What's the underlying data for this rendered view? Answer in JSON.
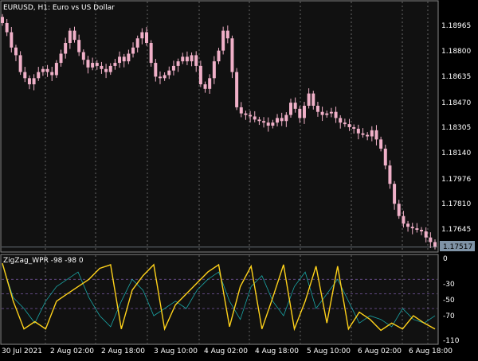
{
  "header": {
    "symbol_info": "EURUSD, H1:  Euro vs US Dollar"
  },
  "indicator": {
    "label": "ZigZag_WPR -98 -98 0"
  },
  "price_axis": {
    "labels": [
      "1.18965",
      "1.18800",
      "1.18635",
      "1.18470",
      "1.18305",
      "1.18140",
      "1.17976",
      "1.17810",
      "1.17645"
    ],
    "current_price": "1.17517"
  },
  "indicator_axis": {
    "labels": [
      "0",
      "-30",
      "-50",
      "-70",
      "-110"
    ]
  },
  "time_axis": {
    "labels": [
      "30 Jul 2021",
      "2 Aug 02:00",
      "2 Aug 18:00",
      "3 Aug 10:00",
      "4 Aug 02:00",
      "4 Aug 18:00",
      "5 Aug 10:00",
      "6 Aug 02:00",
      "6 Aug 18:00"
    ]
  },
  "colors": {
    "background": "#000000",
    "chart_bg": "#111111",
    "grid": "#8a8a8a",
    "candle": "#f0b0c8",
    "zigzag": "#ffd21a",
    "wpr_line": "#1aa6a6",
    "level_line": "#7b5aa6",
    "axis_text": "#ffffff",
    "price_badge": "#7f93a6"
  },
  "chart_data": [
    {
      "type": "candlestick",
      "title": "EURUSD, H1:  Euro vs US Dollar",
      "y_ticks": [
        1.18965,
        1.188,
        1.18635,
        1.1847,
        1.18305,
        1.1814,
        1.17976,
        1.1781,
        1.17645
      ],
      "last_price": 1.17517,
      "ylim": [
        1.1749,
        1.1912
      ],
      "close_path": [
        1.1898,
        1.1892,
        1.1882,
        1.1877,
        1.1866,
        1.1862,
        1.1858,
        1.1862,
        1.1866,
        1.1868,
        1.1866,
        1.1864,
        1.1872,
        1.1878,
        1.1885,
        1.1893,
        1.1887,
        1.1879,
        1.1874,
        1.1869,
        1.1872,
        1.187,
        1.1868,
        1.1866,
        1.187,
        1.1872,
        1.1876,
        1.1873,
        1.1878,
        1.1882,
        1.1888,
        1.1892,
        1.1885,
        1.1872,
        1.1863,
        1.1862,
        1.1864,
        1.1867,
        1.187,
        1.1873,
        1.1876,
        1.1873,
        1.1877,
        1.187,
        1.1858,
        1.1855,
        1.1862,
        1.1873,
        1.188,
        1.1893,
        1.1888,
        1.1866,
        1.1843,
        1.1839,
        1.1838,
        1.1837,
        1.1835,
        1.1834,
        1.1833,
        1.1831,
        1.1833,
        1.1836,
        1.1834,
        1.1838,
        1.1846,
        1.1842,
        1.1836,
        1.1844,
        1.1852,
        1.1844,
        1.184,
        1.1838,
        1.1839,
        1.184,
        1.1836,
        1.1833,
        1.1832,
        1.183,
        1.1829,
        1.1826,
        1.1825,
        1.1824,
        1.1828,
        1.1822,
        1.1816,
        1.1805,
        1.1793,
        1.178,
        1.1772,
        1.1767,
        1.1765,
        1.1764,
        1.1763,
        1.1762,
        1.1758,
        1.1755,
        1.1752
      ]
    },
    {
      "type": "line",
      "title": "ZigZag_WPR -98 -98 0",
      "y_ticks": [
        0,
        -30,
        -50,
        -70,
        -110
      ],
      "levels": [
        -30,
        -50,
        -70
      ],
      "ylim": [
        -118,
        3
      ],
      "series": [
        {
          "values": [
            -8,
            -60,
            -98,
            -88,
            -98,
            -60,
            -50,
            -40,
            -30,
            -15,
            -10,
            -98,
            -45,
            -25,
            -10,
            -98,
            -65,
            -50,
            -35,
            -20,
            -10,
            -95,
            -40,
            -12,
            -98,
            -55,
            -10,
            -98,
            -60,
            -12,
            -90,
            -12,
            -98,
            -75,
            -85,
            -100,
            -90,
            -98,
            -80,
            -90,
            -98
          ]
        },
        {
          "values": [
            -10,
            -55,
            -70,
            -90,
            -60,
            -40,
            -30,
            -20,
            -55,
            -80,
            -95,
            -60,
            -30,
            -45,
            -80,
            -70,
            -60,
            -70,
            -45,
            -30,
            -20,
            -60,
            -85,
            -40,
            -25,
            -60,
            -80,
            -40,
            -20,
            -70,
            -50,
            -30,
            -60,
            -90,
            -80,
            -85,
            -95,
            -70,
            -85,
            -90,
            -80
          ]
        }
      ]
    }
  ]
}
